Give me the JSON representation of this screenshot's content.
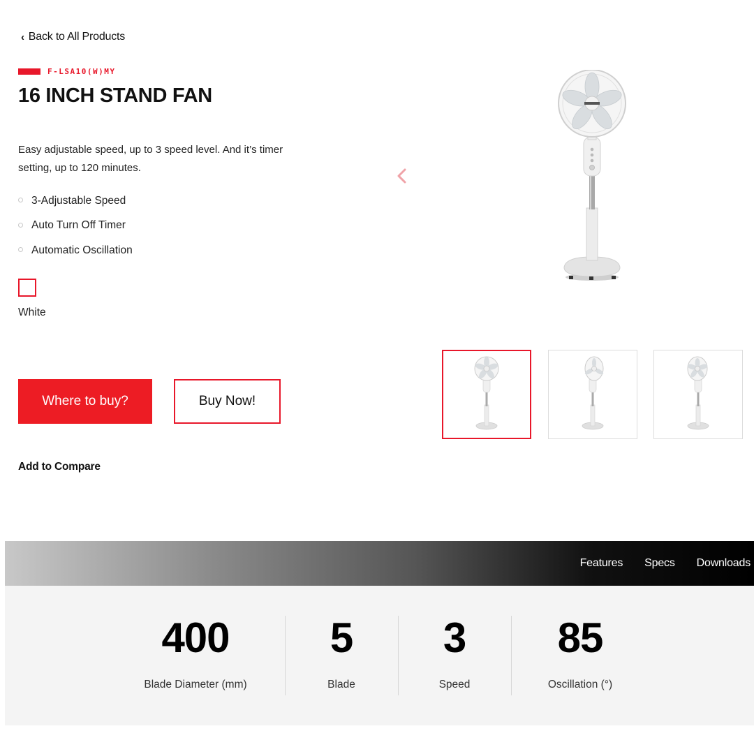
{
  "nav": {
    "back_label": "Back to All Products"
  },
  "product": {
    "model_code": "F-LSA10(W)MY",
    "title": "16 INCH STAND FAN",
    "description": "Easy adjustable speed, up to 3 speed level. And it’s timer setting, up to 120 minutes.",
    "features": [
      "3-Adjustable Speed",
      "Auto Turn Off Timer",
      "Automatic Oscillation"
    ],
    "color_label": "White"
  },
  "actions": {
    "where_to_buy": "Where to buy?",
    "buy_now": "Buy Now!",
    "add_to_compare": "Add to Compare"
  },
  "tabs": [
    {
      "label": "Features"
    },
    {
      "label": "Specs"
    },
    {
      "label": "Downloads"
    }
  ],
  "specs": [
    {
      "value": "400",
      "label": "Blade Diameter (mm)"
    },
    {
      "value": "5",
      "label": "Blade"
    },
    {
      "value": "3",
      "label": "Speed"
    },
    {
      "value": "85",
      "label": "Oscillation (°)"
    }
  ],
  "gallery": {
    "thumbnail_count": 3,
    "active_thumbnail": 1
  },
  "colors": {
    "accent": "#ed1c24",
    "swatch_white": "#ffffff"
  },
  "icons": {
    "back": "chevron-left-icon",
    "prev_image": "chevron-left-icon"
  }
}
